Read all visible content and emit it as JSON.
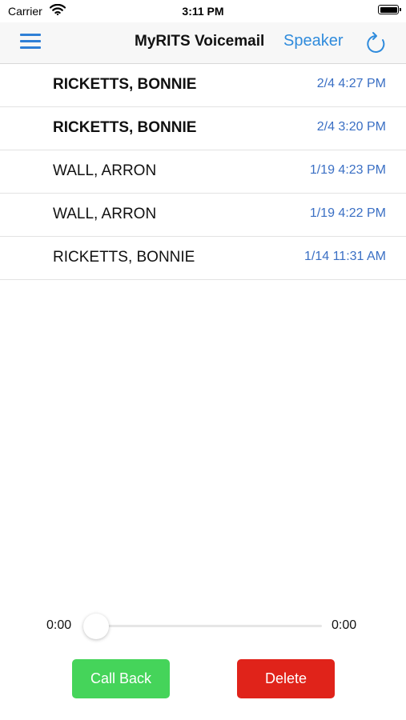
{
  "status_bar": {
    "carrier": "Carrier",
    "time": "3:11 PM",
    "battery_level": 1.0
  },
  "nav": {
    "title": "MyRITS Voicemail",
    "speaker_label": "Speaker",
    "menu_icon": "hamburger-menu-icon",
    "refresh_icon": "refresh-icon",
    "accent_color": "#2f7fd6"
  },
  "voicemails": [
    {
      "name": "RICKETTS, BONNIE",
      "date": "2/4 4:27 PM",
      "unread": true
    },
    {
      "name": "RICKETTS, BONNIE",
      "date": "2/4 3:20 PM",
      "unread": true
    },
    {
      "name": "WALL, ARRON",
      "date": "1/19 4:23 PM",
      "unread": false
    },
    {
      "name": "WALL, ARRON",
      "date": "1/19 4:22 PM",
      "unread": false
    },
    {
      "name": "RICKETTS, BONNIE",
      "date": "1/14 11:31 AM",
      "unread": false
    }
  ],
  "player": {
    "elapsed": "0:00",
    "duration": "0:00",
    "progress": 0
  },
  "actions": {
    "call_back_label": "Call Back",
    "delete_label": "Delete",
    "call_back_color": "#45d45a",
    "delete_color": "#e0231a"
  }
}
